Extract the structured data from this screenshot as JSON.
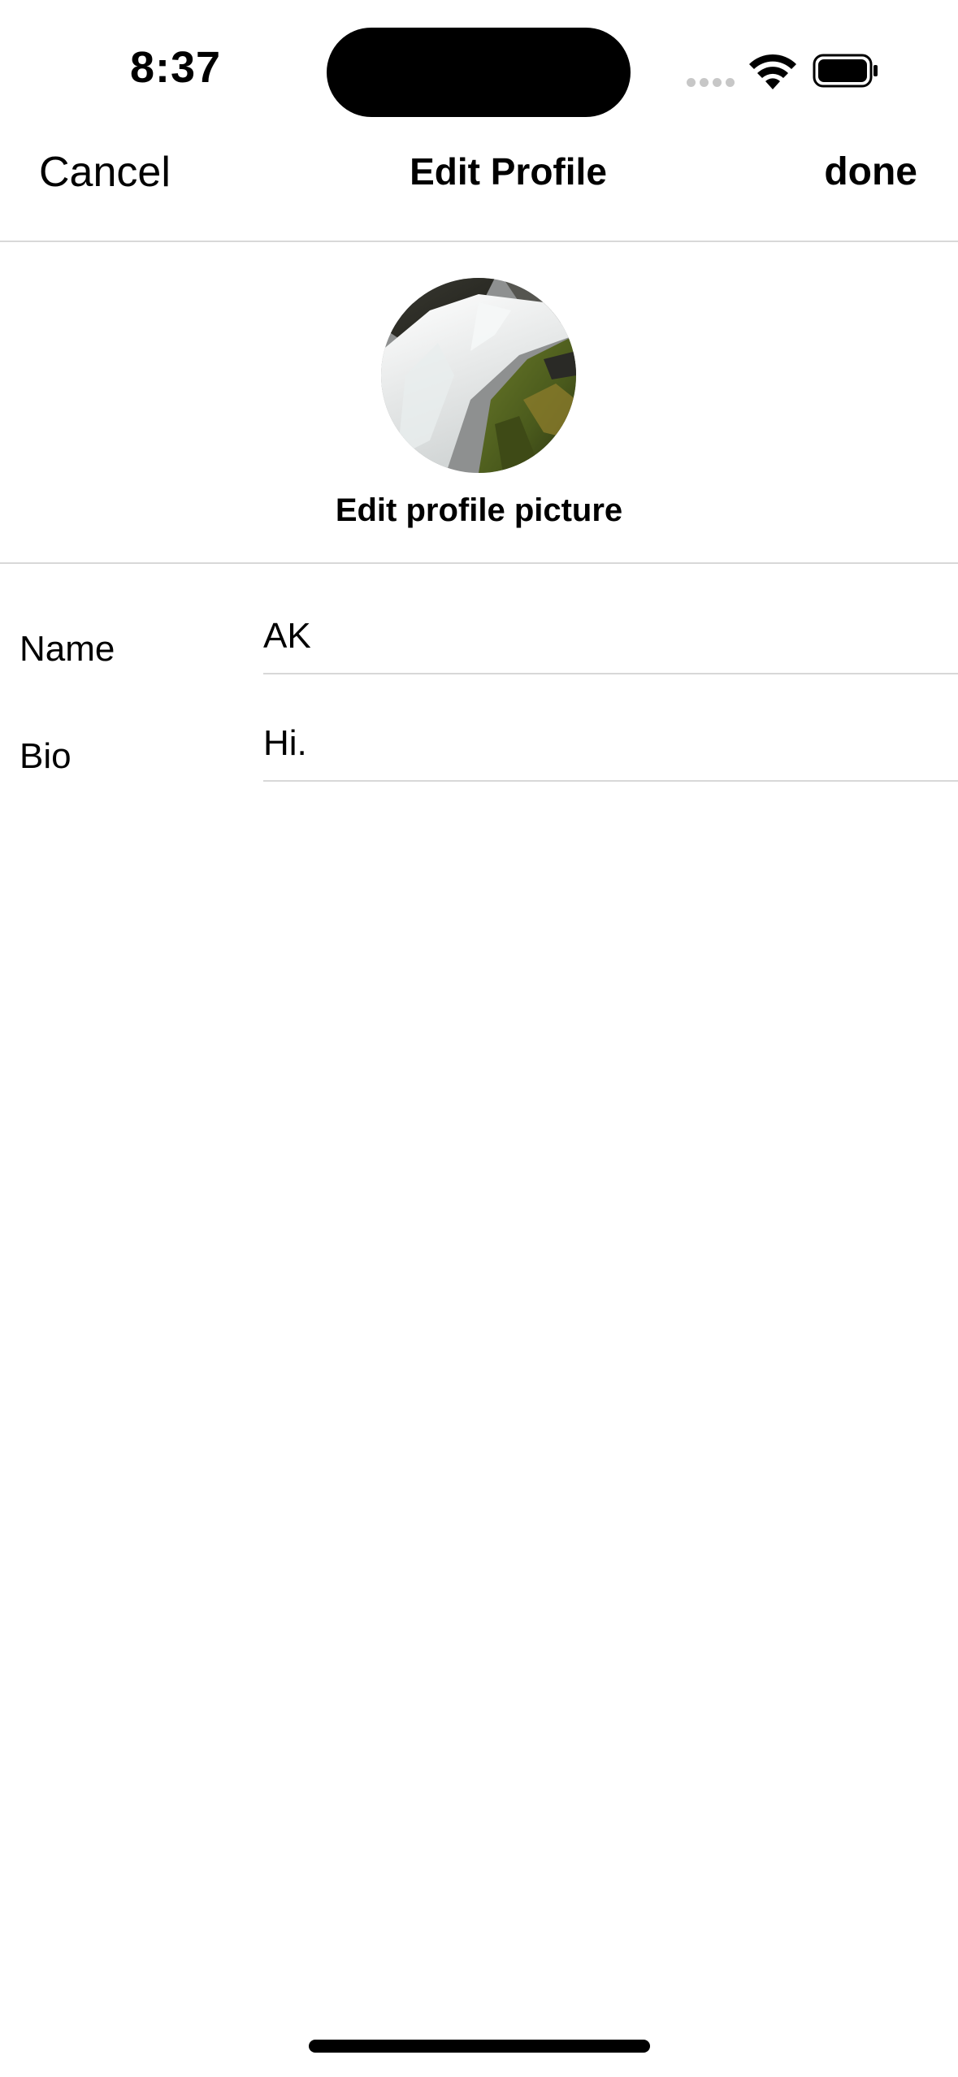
{
  "status_bar": {
    "time": "8:37",
    "icons": [
      "cellular-signal-icon",
      "wifi-icon",
      "battery-icon"
    ]
  },
  "nav": {
    "cancel_label": "Cancel",
    "title": "Edit Profile",
    "done_label": "done"
  },
  "profile": {
    "avatar_description_icon": "waterfall-photo-avatar",
    "edit_picture_label": "Edit profile picture"
  },
  "form": {
    "name_label": "Name",
    "name_value": "AK",
    "bio_label": "Bio",
    "bio_value": "Hi."
  },
  "colors": {
    "text": "#000000",
    "divider": "#d8d8d8",
    "background": "#ffffff"
  }
}
